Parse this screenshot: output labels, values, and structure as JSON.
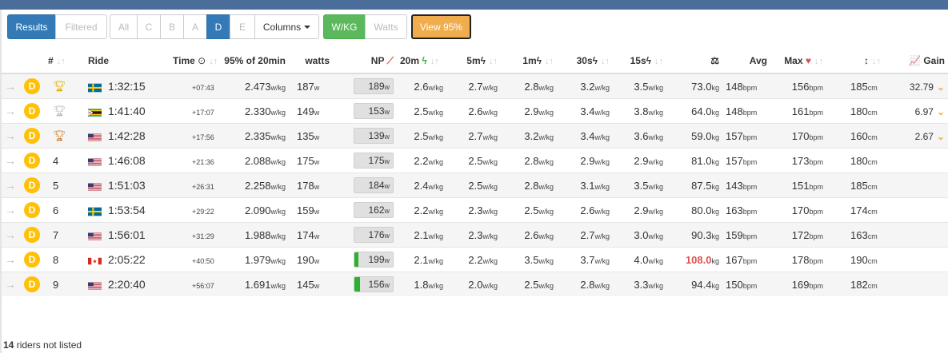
{
  "toolbar": {
    "results": "Results",
    "filtered": "Filtered",
    "cats": [
      "All",
      "C",
      "B",
      "A",
      "D",
      "E"
    ],
    "active_cat": "D",
    "columns": "Columns",
    "wkg": "W/KG",
    "watts": "Watts",
    "view95": "View 95%"
  },
  "headers": {
    "pos": "#",
    "rider": "Ride",
    "time": "Time",
    "p95": "95% of 20min",
    "watts": "watts",
    "np": "NP",
    "m20": "20m",
    "m5": "5m",
    "m1": "1m",
    "s30": "30s",
    "s15": "15s",
    "avg": "Avg",
    "max": "Max",
    "gain": "Gain"
  },
  "units": {
    "wkg": "w/kg",
    "w": "w",
    "kg": "kg",
    "bpm": "bpm",
    "cm": "cm"
  },
  "colors": {
    "primary": "#337ab7",
    "green": "#5cb85c",
    "orange": "#f0ad4e",
    "cat": "#ffc107",
    "np_fill": "#2bb12b",
    "heavy": "#d9534f"
  },
  "rows": [
    {
      "cat": "D",
      "pos": "",
      "trophy": "gold",
      "flag": "SE",
      "time": "1:32:15",
      "gap": "+07:43",
      "p95": "2.473",
      "watts": "187",
      "np": "189",
      "np_fill": 0,
      "m20": "2.6",
      "m5": "2.7",
      "m1": "2.8",
      "s30": "3.2",
      "s15": "3.5",
      "weight": "73.0",
      "heavy": false,
      "avg": "148",
      "max": "156",
      "height": "185",
      "gain": "32.79"
    },
    {
      "cat": "D",
      "pos": "",
      "trophy": "silver",
      "flag": "ZW",
      "time": "1:41:40",
      "gap": "+17:07",
      "p95": "2.330",
      "watts": "149",
      "np": "153",
      "np_fill": 0,
      "m20": "2.5",
      "m5": "2.6",
      "m1": "2.9",
      "s30": "3.4",
      "s15": "3.8",
      "weight": "64.0",
      "heavy": false,
      "avg": "148",
      "max": "161",
      "height": "180",
      "gain": "6.97"
    },
    {
      "cat": "D",
      "pos": "",
      "trophy": "bronze",
      "flag": "US",
      "time": "1:42:28",
      "gap": "+17:56",
      "p95": "2.335",
      "watts": "135",
      "np": "139",
      "np_fill": 0,
      "m20": "2.5",
      "m5": "2.7",
      "m1": "3.2",
      "s30": "3.4",
      "s15": "3.6",
      "weight": "59.0",
      "heavy": false,
      "avg": "157",
      "max": "170",
      "height": "160",
      "gain": "2.67"
    },
    {
      "cat": "D",
      "pos": "4",
      "trophy": "",
      "flag": "US",
      "time": "1:46:08",
      "gap": "+21:36",
      "p95": "2.088",
      "watts": "175",
      "np": "175",
      "np_fill": 0,
      "m20": "2.2",
      "m5": "2.5",
      "m1": "2.8",
      "s30": "2.9",
      "s15": "2.9",
      "weight": "81.0",
      "heavy": false,
      "avg": "157",
      "max": "173",
      "height": "180",
      "gain": ""
    },
    {
      "cat": "D",
      "pos": "5",
      "trophy": "",
      "flag": "US",
      "time": "1:51:03",
      "gap": "+26:31",
      "p95": "2.258",
      "watts": "178",
      "np": "184",
      "np_fill": 0,
      "m20": "2.4",
      "m5": "2.5",
      "m1": "2.8",
      "s30": "3.1",
      "s15": "3.5",
      "weight": "87.5",
      "heavy": false,
      "avg": "143",
      "max": "151",
      "height": "185",
      "gain": ""
    },
    {
      "cat": "D",
      "pos": "6",
      "trophy": "",
      "flag": "SE",
      "time": "1:53:54",
      "gap": "+29:22",
      "p95": "2.090",
      "watts": "159",
      "np": "162",
      "np_fill": 0,
      "m20": "2.2",
      "m5": "2.3",
      "m1": "2.5",
      "s30": "2.6",
      "s15": "2.9",
      "weight": "80.0",
      "heavy": false,
      "avg": "163",
      "max": "170",
      "height": "174",
      "gain": ""
    },
    {
      "cat": "D",
      "pos": "7",
      "trophy": "",
      "flag": "US",
      "time": "1:56:01",
      "gap": "+31:29",
      "p95": "1.988",
      "watts": "174",
      "np": "176",
      "np_fill": 0,
      "m20": "2.1",
      "m5": "2.3",
      "m1": "2.6",
      "s30": "2.7",
      "s15": "3.0",
      "weight": "90.3",
      "heavy": false,
      "avg": "159",
      "max": "172",
      "height": "163",
      "gain": ""
    },
    {
      "cat": "D",
      "pos": "8",
      "trophy": "",
      "flag": "CA",
      "time": "2:05:22",
      "gap": "+40:50",
      "p95": "1.979",
      "watts": "190",
      "np": "199",
      "np_fill": 0.1,
      "m20": "2.1",
      "m5": "2.2",
      "m1": "3.5",
      "s30": "3.7",
      "s15": "4.0",
      "weight": "108.0",
      "heavy": true,
      "avg": "167",
      "max": "178",
      "height": "190",
      "gain": ""
    },
    {
      "cat": "D",
      "pos": "9",
      "trophy": "",
      "flag": "US",
      "time": "2:20:40",
      "gap": "+56:07",
      "p95": "1.691",
      "watts": "145",
      "np": "156",
      "np_fill": 0.14,
      "m20": "1.8",
      "m5": "2.0",
      "m1": "2.5",
      "s30": "2.8",
      "s15": "3.3",
      "weight": "94.4",
      "heavy": false,
      "avg": "150",
      "max": "169",
      "height": "182",
      "gain": ""
    }
  ],
  "footer": {
    "count": "14",
    "text": "riders not listed"
  }
}
